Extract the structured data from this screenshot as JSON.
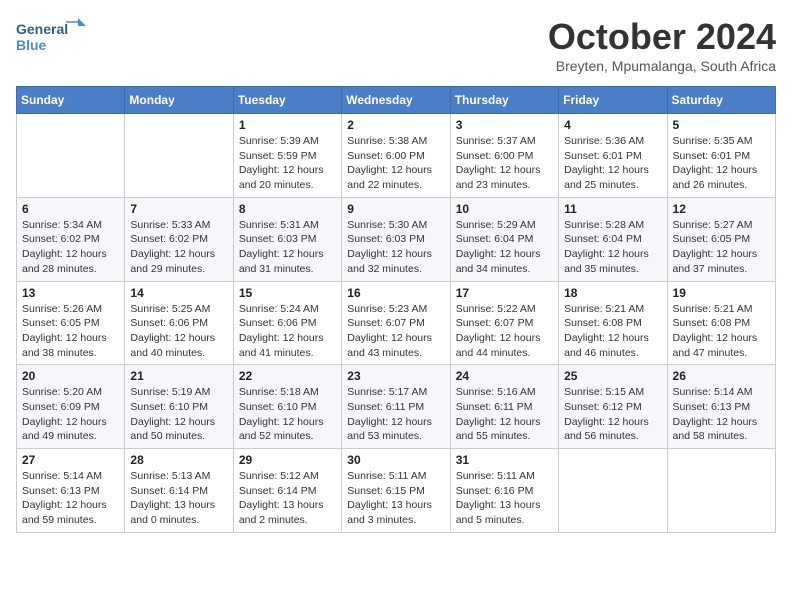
{
  "logo": {
    "line1": "General",
    "line2": "Blue"
  },
  "title": "October 2024",
  "subtitle": "Breyten, Mpumalanga, South Africa",
  "days_of_week": [
    "Sunday",
    "Monday",
    "Tuesday",
    "Wednesday",
    "Thursday",
    "Friday",
    "Saturday"
  ],
  "weeks": [
    [
      {
        "day": "",
        "info": ""
      },
      {
        "day": "",
        "info": ""
      },
      {
        "day": "1",
        "info": "Sunrise: 5:39 AM\nSunset: 5:59 PM\nDaylight: 12 hours\nand 20 minutes."
      },
      {
        "day": "2",
        "info": "Sunrise: 5:38 AM\nSunset: 6:00 PM\nDaylight: 12 hours\nand 22 minutes."
      },
      {
        "day": "3",
        "info": "Sunrise: 5:37 AM\nSunset: 6:00 PM\nDaylight: 12 hours\nand 23 minutes."
      },
      {
        "day": "4",
        "info": "Sunrise: 5:36 AM\nSunset: 6:01 PM\nDaylight: 12 hours\nand 25 minutes."
      },
      {
        "day": "5",
        "info": "Sunrise: 5:35 AM\nSunset: 6:01 PM\nDaylight: 12 hours\nand 26 minutes."
      }
    ],
    [
      {
        "day": "6",
        "info": "Sunrise: 5:34 AM\nSunset: 6:02 PM\nDaylight: 12 hours\nand 28 minutes."
      },
      {
        "day": "7",
        "info": "Sunrise: 5:33 AM\nSunset: 6:02 PM\nDaylight: 12 hours\nand 29 minutes."
      },
      {
        "day": "8",
        "info": "Sunrise: 5:31 AM\nSunset: 6:03 PM\nDaylight: 12 hours\nand 31 minutes."
      },
      {
        "day": "9",
        "info": "Sunrise: 5:30 AM\nSunset: 6:03 PM\nDaylight: 12 hours\nand 32 minutes."
      },
      {
        "day": "10",
        "info": "Sunrise: 5:29 AM\nSunset: 6:04 PM\nDaylight: 12 hours\nand 34 minutes."
      },
      {
        "day": "11",
        "info": "Sunrise: 5:28 AM\nSunset: 6:04 PM\nDaylight: 12 hours\nand 35 minutes."
      },
      {
        "day": "12",
        "info": "Sunrise: 5:27 AM\nSunset: 6:05 PM\nDaylight: 12 hours\nand 37 minutes."
      }
    ],
    [
      {
        "day": "13",
        "info": "Sunrise: 5:26 AM\nSunset: 6:05 PM\nDaylight: 12 hours\nand 38 minutes."
      },
      {
        "day": "14",
        "info": "Sunrise: 5:25 AM\nSunset: 6:06 PM\nDaylight: 12 hours\nand 40 minutes."
      },
      {
        "day": "15",
        "info": "Sunrise: 5:24 AM\nSunset: 6:06 PM\nDaylight: 12 hours\nand 41 minutes."
      },
      {
        "day": "16",
        "info": "Sunrise: 5:23 AM\nSunset: 6:07 PM\nDaylight: 12 hours\nand 43 minutes."
      },
      {
        "day": "17",
        "info": "Sunrise: 5:22 AM\nSunset: 6:07 PM\nDaylight: 12 hours\nand 44 minutes."
      },
      {
        "day": "18",
        "info": "Sunrise: 5:21 AM\nSunset: 6:08 PM\nDaylight: 12 hours\nand 46 minutes."
      },
      {
        "day": "19",
        "info": "Sunrise: 5:21 AM\nSunset: 6:08 PM\nDaylight: 12 hours\nand 47 minutes."
      }
    ],
    [
      {
        "day": "20",
        "info": "Sunrise: 5:20 AM\nSunset: 6:09 PM\nDaylight: 12 hours\nand 49 minutes."
      },
      {
        "day": "21",
        "info": "Sunrise: 5:19 AM\nSunset: 6:10 PM\nDaylight: 12 hours\nand 50 minutes."
      },
      {
        "day": "22",
        "info": "Sunrise: 5:18 AM\nSunset: 6:10 PM\nDaylight: 12 hours\nand 52 minutes."
      },
      {
        "day": "23",
        "info": "Sunrise: 5:17 AM\nSunset: 6:11 PM\nDaylight: 12 hours\nand 53 minutes."
      },
      {
        "day": "24",
        "info": "Sunrise: 5:16 AM\nSunset: 6:11 PM\nDaylight: 12 hours\nand 55 minutes."
      },
      {
        "day": "25",
        "info": "Sunrise: 5:15 AM\nSunset: 6:12 PM\nDaylight: 12 hours\nand 56 minutes."
      },
      {
        "day": "26",
        "info": "Sunrise: 5:14 AM\nSunset: 6:13 PM\nDaylight: 12 hours\nand 58 minutes."
      }
    ],
    [
      {
        "day": "27",
        "info": "Sunrise: 5:14 AM\nSunset: 6:13 PM\nDaylight: 12 hours\nand 59 minutes."
      },
      {
        "day": "28",
        "info": "Sunrise: 5:13 AM\nSunset: 6:14 PM\nDaylight: 13 hours\nand 0 minutes."
      },
      {
        "day": "29",
        "info": "Sunrise: 5:12 AM\nSunset: 6:14 PM\nDaylight: 13 hours\nand 2 minutes."
      },
      {
        "day": "30",
        "info": "Sunrise: 5:11 AM\nSunset: 6:15 PM\nDaylight: 13 hours\nand 3 minutes."
      },
      {
        "day": "31",
        "info": "Sunrise: 5:11 AM\nSunset: 6:16 PM\nDaylight: 13 hours\nand 5 minutes."
      },
      {
        "day": "",
        "info": ""
      },
      {
        "day": "",
        "info": ""
      }
    ]
  ]
}
